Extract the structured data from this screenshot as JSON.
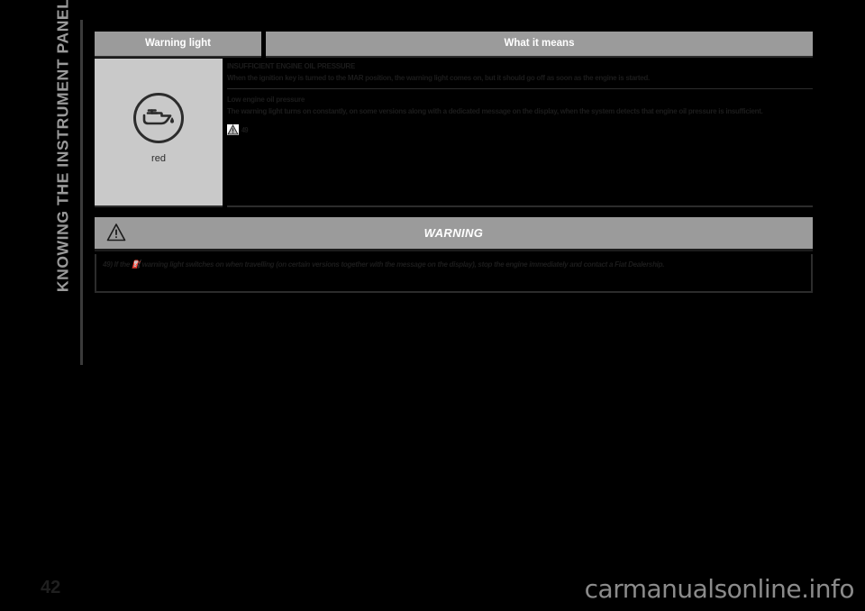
{
  "chapter": {
    "title": "KNOWING THE INSTRUMENT PANEL"
  },
  "table": {
    "headers": {
      "warning_light": "Warning light",
      "what_it_means": "What it means"
    },
    "light_cell": {
      "icon_name": "oil-pressure-telltale-icon",
      "colour_label": "red"
    },
    "sections": [
      {
        "heading": "INSUFFICIENT ENGINE OIL PRESSURE",
        "body": "When the ignition key is turned to the MAR position, the warning light comes on, but it should go off as soon as the engine is started."
      },
      {
        "heading": "Low engine oil pressure",
        "body": "The warning light turns on constantly, on some versions along with a dedicated message on the display, when the system detects that engine oil pressure is insufficient."
      }
    ],
    "reference": {
      "icon_name": "warning-triangle-icon",
      "number": "49"
    }
  },
  "warning": {
    "title": "WARNING",
    "icon_name": "warning-triangle-icon",
    "text": "49) If the ⛽ warning light switches on when travelling (on certain versions together with the message on the display), stop the engine immediately and contact a Fiat Dealership."
  },
  "footer": {
    "page_number": "42",
    "watermark": "carmanualsonline.info"
  },
  "colors": {
    "page_background": "#000000",
    "header_gray": "#9b9b9b",
    "cell_gray": "#c9c9c9",
    "ink": "#1c1c1c",
    "chapter_text": "#9a9a9a",
    "watermark": "#8b8b8b"
  }
}
